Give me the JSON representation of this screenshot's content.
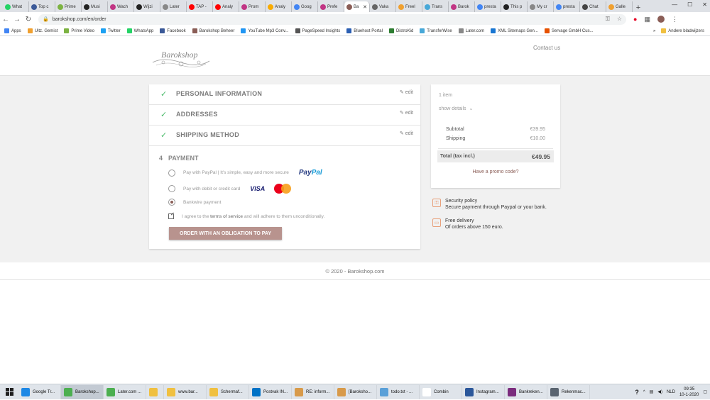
{
  "browser": {
    "tabs": [
      {
        "label": "What",
        "color": "#25d366"
      },
      {
        "label": "Top c",
        "color": "#3b5998"
      },
      {
        "label": "Prime",
        "color": "#7cb342"
      },
      {
        "label": "Musi",
        "color": "#222222"
      },
      {
        "label": "Wach",
        "color": "#c13584"
      },
      {
        "label": "Wijzi",
        "color": "#222222"
      },
      {
        "label": "Later",
        "color": "#888888"
      },
      {
        "label": "TAP -",
        "color": "#ff0000"
      },
      {
        "label": "Analy",
        "color": "#ff0000"
      },
      {
        "label": "Prom",
        "color": "#c13584"
      },
      {
        "label": "Analy",
        "color": "#f9ab00"
      },
      {
        "label": "Goog",
        "color": "#4285f4"
      },
      {
        "label": "Prefe",
        "color": "#c13584"
      },
      {
        "label": "Ba",
        "color": "#8a5d56",
        "active": true
      },
      {
        "label": "Vaka",
        "color": "#666666"
      },
      {
        "label": "Freel",
        "color": "#f0a030"
      },
      {
        "label": "Trans",
        "color": "#48a8d8"
      },
      {
        "label": "Barok",
        "color": "#c13584"
      },
      {
        "label": "presta",
        "color": "#4285f4"
      },
      {
        "label": "This p",
        "color": "#222222"
      },
      {
        "label": "My cr",
        "color": "#888888"
      },
      {
        "label": "presta",
        "color": "#4285f4"
      },
      {
        "label": "Chat",
        "color": "#444444"
      },
      {
        "label": "Galle",
        "color": "#f0a030"
      }
    ],
    "url": "barokshop.com/en/order",
    "bookmarks": [
      {
        "label": "Apps",
        "color": "#4285f4"
      },
      {
        "label": "Uitz. Gemist",
        "color": "#f0a030"
      },
      {
        "label": "Prime Video",
        "color": "#7cb342"
      },
      {
        "label": "Twitter",
        "color": "#1da1f2"
      },
      {
        "label": "WhatsApp",
        "color": "#25d366"
      },
      {
        "label": "Facebook",
        "color": "#3b5998"
      },
      {
        "label": "Barokshop Beheer",
        "color": "#8a5d56"
      },
      {
        "label": "YouTube Mp3 Conv...",
        "color": "#2196f3"
      },
      {
        "label": "PageSpeed Insights",
        "color": "#555555"
      },
      {
        "label": "Bluehost Portal",
        "color": "#2b5fb3"
      },
      {
        "label": "DistroKid",
        "color": "#2e7d32"
      },
      {
        "label": "TransferWise",
        "color": "#48a8d8"
      },
      {
        "label": "Later.com",
        "color": "#888888"
      },
      {
        "label": "XML Sitemaps Gen...",
        "color": "#1976d2"
      },
      {
        "label": "Servage GmbH Cus...",
        "color": "#e65100"
      }
    ],
    "other_bookmarks": "Andere bladwijzers"
  },
  "header": {
    "logo_text": "Barokshop",
    "contact_label": "Contact us"
  },
  "checkout": {
    "steps": [
      {
        "title": "PERSONAL INFORMATION",
        "edit": "edit"
      },
      {
        "title": "ADDRESSES",
        "edit": "edit"
      },
      {
        "title": "SHIPPING METHOD",
        "edit": "edit"
      }
    ],
    "payment": {
      "number": "4",
      "title": "PAYMENT",
      "options": [
        {
          "label": "Pay with PayPal | It's simple, easy and more secure",
          "selected": false
        },
        {
          "label": "Pay with debit or credit card",
          "selected": false
        },
        {
          "label": "Bankwire payment",
          "selected": true
        }
      ],
      "paypal_logo": {
        "a": "Pay",
        "b": "Pal"
      },
      "visa_logo": "VISA",
      "terms_prefix": "I agree to the",
      "terms_link": "terms of service",
      "terms_suffix": "and will adhere to them unconditionally.",
      "order_button": "ORDER WITH AN OBLIGATION TO PAY"
    }
  },
  "summary": {
    "items_count": "1 item",
    "show_details": "show details",
    "subtotal_label": "Subtotal",
    "subtotal_value": "€39.95",
    "shipping_label": "Shipping",
    "shipping_value": "€10.00",
    "total_label": "Total (tax incl.)",
    "total_value": "€49.95",
    "promo": "Have a promo code?"
  },
  "reassurance": [
    {
      "title": "Security policy",
      "text": "Secure payment through Paypal or your bank."
    },
    {
      "title": "Free delivery",
      "text": "Of orders above 150 euro."
    }
  ],
  "footer": "© 2020 - Barokshop.com",
  "taskbar": {
    "items": [
      {
        "label": "Google Tr...",
        "color": "#1e88e5"
      },
      {
        "label": "Barokshop...",
        "color": "#4caf50",
        "active": true
      },
      {
        "label": "Later.com ...",
        "color": "#4caf50"
      },
      {
        "label": "",
        "color": "#f0c040",
        "small": true
      },
      {
        "label": "www.bar...",
        "color": "#f0c040"
      },
      {
        "label": "Schermaf...",
        "color": "#f0c040"
      },
      {
        "label": "Postvak IN...",
        "color": "#0072c6"
      },
      {
        "label": "RE: inform...",
        "color": "#d89a4a"
      },
      {
        "label": "[Baroksho...",
        "color": "#d89a4a"
      },
      {
        "label": "todo.txt - ...",
        "color": "#5aa0d8"
      },
      {
        "label": "Combin",
        "color": "#ffffff"
      },
      {
        "label": "Instagram...",
        "color": "#2b579a"
      },
      {
        "label": "Bankreken...",
        "color": "#7b2c7d"
      },
      {
        "label": "Rekenmac...",
        "color": "#5a6470"
      }
    ],
    "language": "NLD",
    "time": "09:35",
    "date": "10-1-2020"
  }
}
